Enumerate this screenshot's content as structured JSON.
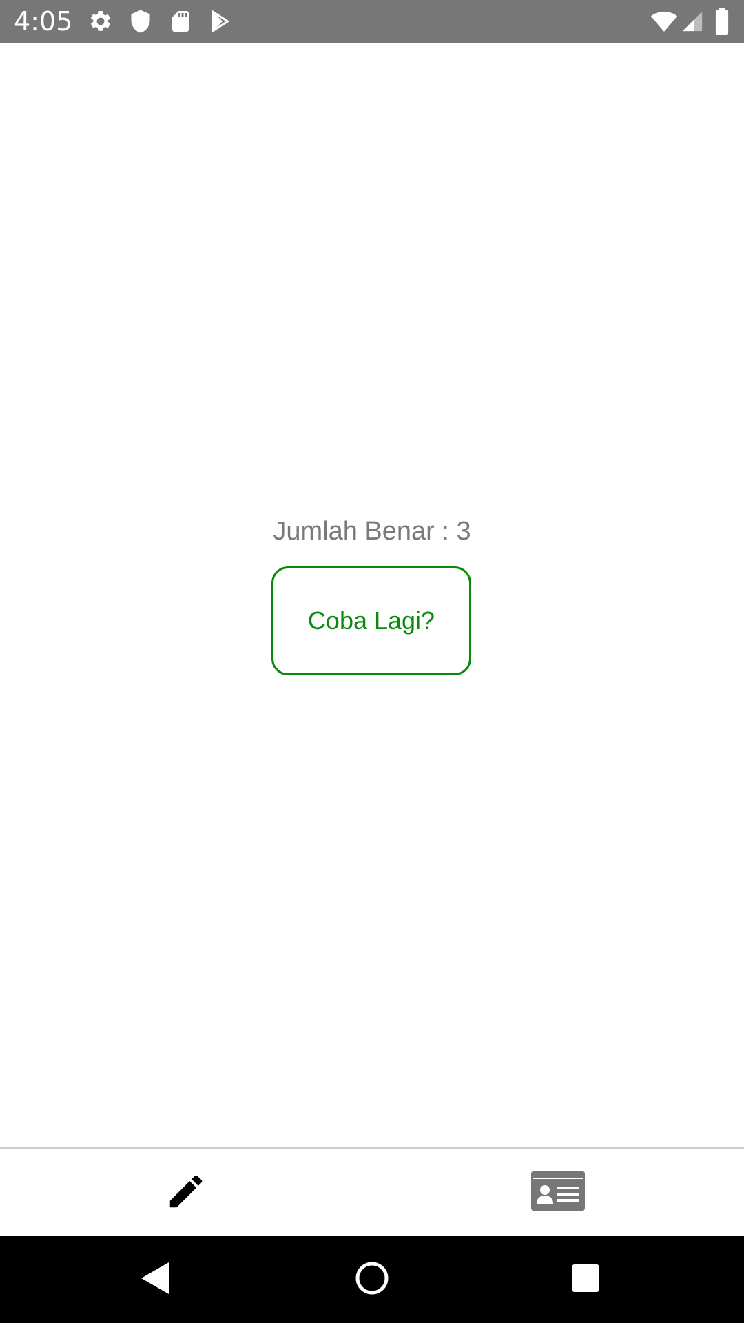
{
  "status_bar": {
    "time": "4:05",
    "left_icons": [
      "settings-icon",
      "shield-icon",
      "sd-card-icon",
      "play-store-icon"
    ],
    "right_icons": [
      "wifi-icon",
      "cell-signal-icon",
      "battery-icon"
    ],
    "background": "#777777"
  },
  "main": {
    "score_text": "Jumlah Benar : 3",
    "retry_label": "Coba Lagi?",
    "accent_color": "#0a8a0a"
  },
  "bottom_nav": {
    "items": [
      {
        "icon": "pencil-icon"
      },
      {
        "icon": "id-card-icon"
      }
    ]
  },
  "system_nav": {
    "buttons": [
      "back-icon",
      "home-icon",
      "recents-icon"
    ]
  }
}
